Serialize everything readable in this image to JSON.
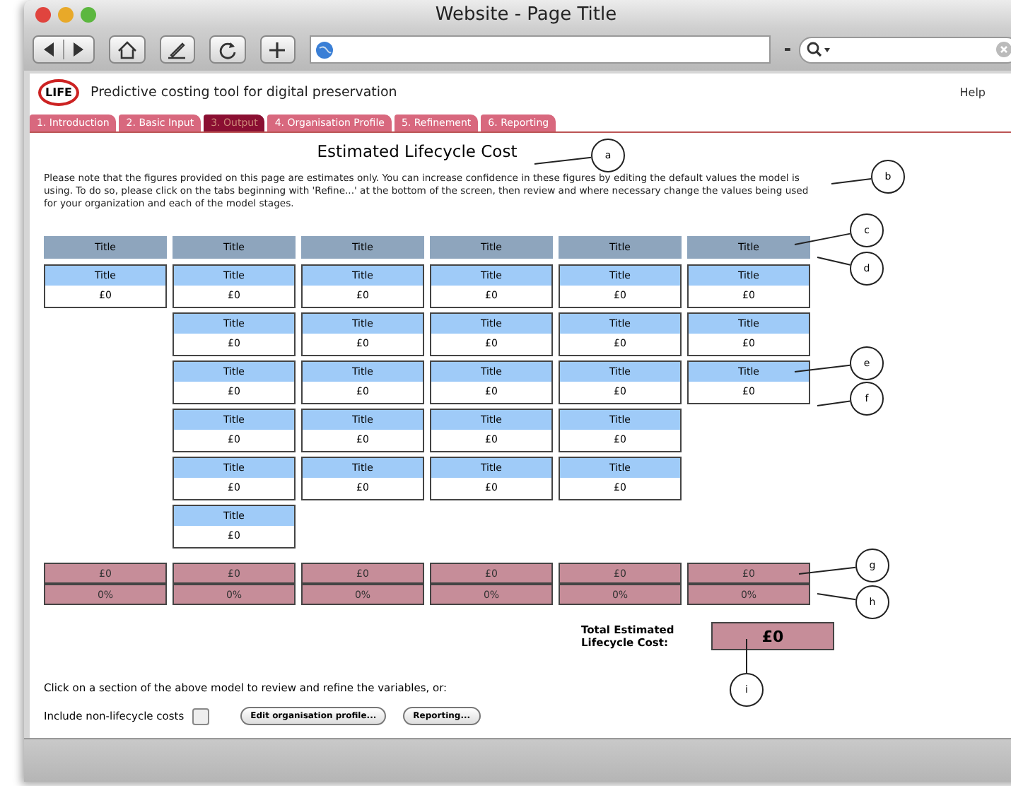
{
  "window": {
    "title": "Website - Page Title"
  },
  "app": {
    "logo": "LIFE",
    "tagline": "Predictive costing tool for digital preservation",
    "help": "Help"
  },
  "tabs": [
    {
      "label": "1. Introduction",
      "selected": false
    },
    {
      "label": "2. Basic Input",
      "selected": false
    },
    {
      "label": "3. Output",
      "selected": true
    },
    {
      "label": "4. Organisation Profile",
      "selected": false
    },
    {
      "label": "5. Refinement",
      "selected": false
    },
    {
      "label": "6. Reporting",
      "selected": false
    }
  ],
  "heading": "Estimated Lifecycle Cost",
  "intro": "Please note that the figures provided on this page are estimates only. You can increase confidence in these figures by editing the default values the model is using. To do so, please click on the tabs beginning with 'Refine...' at the bottom of the screen, then review and where necessary change the values being used for your organization and each of the model stages.",
  "columns": [
    {
      "header": "Title",
      "cards": [
        {
          "title": "Title",
          "value": "£0"
        }
      ],
      "total": "£0",
      "percent": "0%"
    },
    {
      "header": "Title",
      "cards": [
        {
          "title": "Title",
          "value": "£0"
        },
        {
          "title": "Title",
          "value": "£0"
        },
        {
          "title": "Title",
          "value": "£0"
        },
        {
          "title": "Title",
          "value": "£0"
        },
        {
          "title": "Title",
          "value": "£0"
        },
        {
          "title": "Title",
          "value": "£0"
        }
      ],
      "total": "£0",
      "percent": "0%"
    },
    {
      "header": "Title",
      "cards": [
        {
          "title": "Title",
          "value": "£0"
        },
        {
          "title": "Title",
          "value": "£0"
        },
        {
          "title": "Title",
          "value": "£0"
        },
        {
          "title": "Title",
          "value": "£0"
        },
        {
          "title": "Title",
          "value": "£0"
        }
      ],
      "total": "£0",
      "percent": "0%"
    },
    {
      "header": "Title",
      "cards": [
        {
          "title": "Title",
          "value": "£0"
        },
        {
          "title": "Title",
          "value": "£0"
        },
        {
          "title": "Title",
          "value": "£0"
        },
        {
          "title": "Title",
          "value": "£0"
        },
        {
          "title": "Title",
          "value": "£0"
        }
      ],
      "total": "£0",
      "percent": "0%"
    },
    {
      "header": "Title",
      "cards": [
        {
          "title": "Title",
          "value": "£0"
        },
        {
          "title": "Title",
          "value": "£0"
        },
        {
          "title": "Title",
          "value": "£0"
        },
        {
          "title": "Title",
          "value": "£0"
        },
        {
          "title": "Title",
          "value": "£0"
        }
      ],
      "total": "£0",
      "percent": "0%"
    },
    {
      "header": "Title",
      "cards": [
        {
          "title": "Title",
          "value": "£0"
        },
        {
          "title": "Title",
          "value": "£0"
        },
        {
          "title": "Title",
          "value": "£0"
        }
      ],
      "total": "£0",
      "percent": "0%"
    }
  ],
  "total": {
    "label": "Total Estimated Lifecycle Cost:",
    "value": "£0"
  },
  "footer": {
    "instruction": "Click on a section of the above model to review and refine the variables, or:",
    "checkbox_label": "Include non-lifecycle costs",
    "checked": false,
    "buttons": [
      "Edit organisation profile...",
      "Reporting..."
    ]
  },
  "callouts": [
    "a",
    "b",
    "c",
    "d",
    "e",
    "f",
    "g",
    "h",
    "i"
  ]
}
